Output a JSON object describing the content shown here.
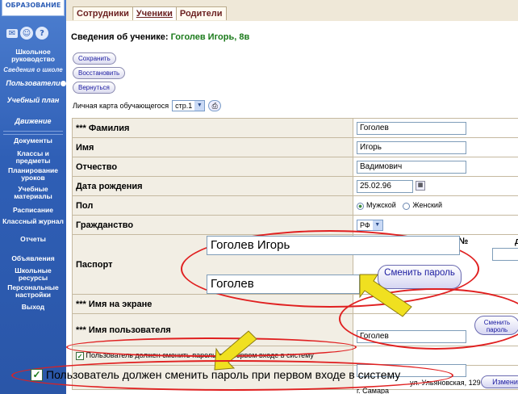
{
  "sidebar": {
    "logo": "ОБРАЗОВАНИЕ",
    "icons": [
      "mail-icon",
      "people-icon",
      "help-icon"
    ],
    "help_label": "?",
    "items": [
      {
        "label": "Школьное руководство",
        "style": "bold"
      },
      {
        "label": "Сведения о школе",
        "style": "sub"
      },
      {
        "label": "Пользователи",
        "style": "ital"
      },
      {
        "label": "Учебный план",
        "style": "ital"
      },
      {
        "label": "Движение",
        "style": "ital"
      },
      {
        "label": "Документы",
        "style": "bold"
      },
      {
        "label": "Классы и предметы",
        "style": "bold"
      },
      {
        "label": "Планирование уроков",
        "style": "bold"
      },
      {
        "label": "Учебные материалы",
        "style": "bold"
      },
      {
        "label": "Расписание",
        "style": "bold"
      },
      {
        "label": "Классный журнал",
        "style": "bold"
      },
      {
        "label": "Отчеты",
        "style": "bold"
      },
      {
        "label": "Объявления",
        "style": "bold"
      },
      {
        "label": "Школьные ресурсы",
        "style": "bold"
      },
      {
        "label": "Персональные настройки",
        "style": "bold"
      },
      {
        "label": "Выход",
        "style": "bold"
      }
    ]
  },
  "tabs": [
    "Сотрудники",
    "Ученики",
    "Родители"
  ],
  "header": {
    "title_prefix": "Сведения об ученике:",
    "student": "Гоголев Игорь, 8в"
  },
  "buttons": {
    "save": "Сохранить",
    "restore": "Восстановить",
    "back": "Вернуться"
  },
  "card": {
    "label": "Личная карта обучающегося",
    "page": "стр.1"
  },
  "form": {
    "surname_label": "*** Фамилия",
    "surname": "Гоголев",
    "name_label": "Имя",
    "name": "Игорь",
    "patronymic_label": "Отчество",
    "patronymic": "Вадимович",
    "birth_label": "Дата рождения",
    "birth": "25.02.96",
    "sex_label": "Пол",
    "sex_male": "Мужской",
    "sex_female": "Женский",
    "citizenship_label": "Гражданство",
    "citizenship": "РФ",
    "passport_label": "Паспорт",
    "passport_col1": "№",
    "passport_col2": "д",
    "screen_name_label": "*** Имя на экране",
    "username_label": "*** Имя пользователя",
    "username": "Гоголев",
    "change_pwd_small": "Сменить пароль",
    "must_change": "Пользователь должен сменить пароль при первом входе в систему",
    "addr_fragment1": "ул. Ульяновская, 129",
    "addr_fragment2": "г. Самара",
    "edit_btn": "Измени"
  },
  "zoom": {
    "screen_name": "Гоголев Игорь",
    "username": "Гоголев",
    "change_pwd": "Сменить пароль"
  },
  "colors": {
    "sidebar": "#2f5fb6",
    "accent_red": "#e02020",
    "arrow": "#f0e020",
    "name_green": "#1a7a1a"
  }
}
